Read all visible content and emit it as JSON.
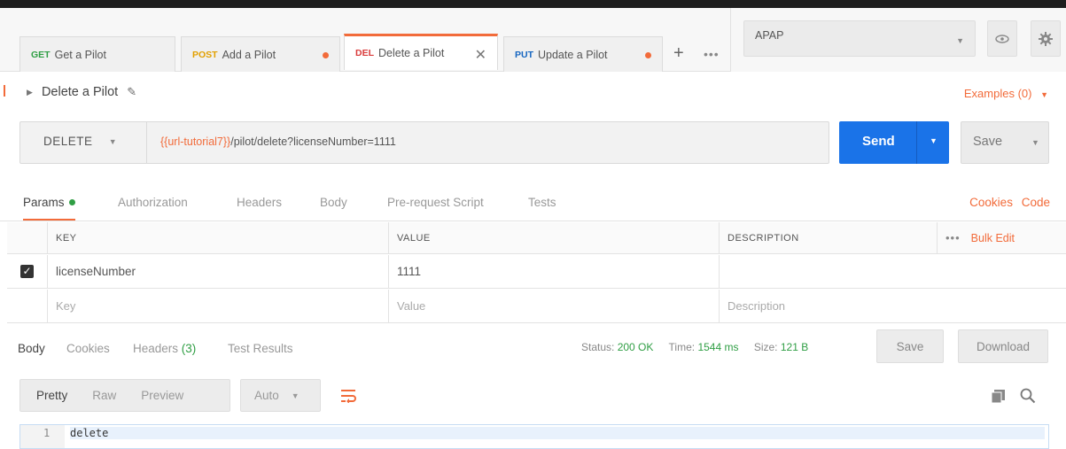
{
  "tabs": [
    {
      "method": "GET",
      "name": "Get a Pilot",
      "unsaved": false,
      "active": false
    },
    {
      "method": "POST",
      "name": "Add a Pilot",
      "unsaved": true,
      "active": false
    },
    {
      "method": "DEL",
      "name": "Delete a Pilot",
      "unsaved": false,
      "active": true
    },
    {
      "method": "PUT",
      "name": "Update a Pilot",
      "unsaved": true,
      "active": false
    }
  ],
  "tab_controls": {
    "add": "+",
    "more": "•••"
  },
  "environment": {
    "selected": "APAP"
  },
  "icons": {
    "eye": "eye-icon",
    "settings": "gear-icon"
  },
  "request": {
    "name": "Delete a Pilot",
    "examples": "Examples (0)",
    "method": "DELETE",
    "url_var": "{{url-tutorial7}}",
    "url_path": "/pilot/delete?licenseNumber=1111",
    "send_label": "Send",
    "save_label": "Save"
  },
  "request_tabs": {
    "items": [
      "Params",
      "Authorization",
      "Headers",
      "Body",
      "Pre-request Script",
      "Tests"
    ],
    "cookies": "Cookies",
    "code": "Code"
  },
  "params": {
    "headers": {
      "key": "KEY",
      "value": "VALUE",
      "description": "DESCRIPTION",
      "more": "•••",
      "bulk_edit": "Bulk Edit"
    },
    "rows": [
      {
        "checked": true,
        "key": "licenseNumber",
        "value": "1111",
        "description": ""
      }
    ],
    "placeholder": {
      "key": "Key",
      "value": "Value",
      "description": "Description"
    }
  },
  "response": {
    "tabs": {
      "body": "Body",
      "cookies": "Cookies",
      "headers": "Headers",
      "headers_count": "(3)",
      "test_results": "Test Results"
    },
    "status_label": "Status:",
    "status_value": "200 OK",
    "time_label": "Time:",
    "time_value": "1544 ms",
    "size_label": "Size:",
    "size_value": "121 B",
    "save": "Save",
    "download": "Download",
    "view_modes": [
      "Pretty",
      "Raw",
      "Preview"
    ],
    "format": "Auto",
    "line_number": "1",
    "body_text": "delete"
  },
  "colors": {
    "accent": "#f26b3a",
    "send": "#1a73e8",
    "success": "#2f9e44"
  }
}
